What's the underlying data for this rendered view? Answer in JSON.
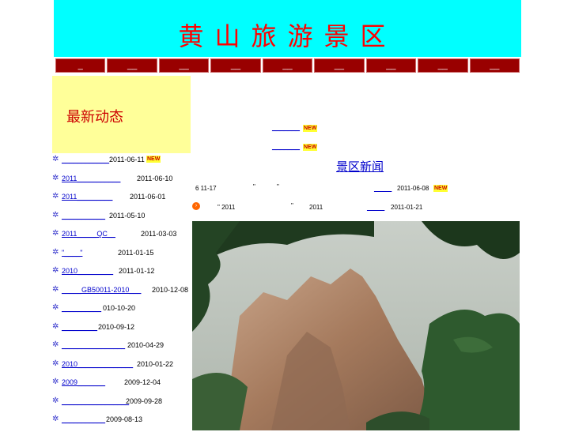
{
  "header": {
    "title": "黄山旅游景区"
  },
  "nav": {
    "items": [
      "_",
      "__",
      "__",
      "__",
      "__",
      "__",
      "__",
      "__",
      "__"
    ]
  },
  "sidebar": {
    "title": "最新动态",
    "items": [
      {
        "link": "____________",
        "date": "2011-06-11",
        "new": "NEW"
      },
      {
        "link": "2011___________",
        "date": "2011-06-10"
      },
      {
        "link": "2011_________",
        "date": "2011-06-01"
      },
      {
        "link": "___________",
        "date": "2011-05-10"
      },
      {
        "link": "2011_____QC__",
        "date": "2011-03-03"
      },
      {
        "link": "\"____\"",
        "date": "2011-01-15"
      },
      {
        "link": "2010_________",
        "date": "2011-01-12"
      },
      {
        "link": "_____GB50011-2010___",
        "date": "2010-12-08"
      },
      {
        "link": "__________",
        "date": "010-10-20"
      },
      {
        "link": "_________",
        "date": "2010-09-12"
      },
      {
        "link": "________________",
        "date": "2010-04-29"
      },
      {
        "link": "2010______________",
        "date": "2010-01-22"
      },
      {
        "link": "2009_______",
        "date": "2009-12-04"
      },
      {
        "link": "_________________",
        "date": "2009-09-28"
      },
      {
        "link": "___________",
        "date": "2009-08-13"
      }
    ]
  },
  "main": {
    "top_links": [
      {
        "text": "_______",
        "new": "NEW"
      },
      {
        "text": "_______",
        "new": "NEW"
      }
    ],
    "section_title": "景区新闻",
    "rows": [
      {
        "prefix": "6 11-17",
        "quote1": "\"",
        "quote2": "\"",
        "link": "_____",
        "date": "2011-06-08",
        "new": "NEW"
      },
      {
        "prefix": "\" 2011",
        "quote1": "\"",
        "mid": "2011",
        "link": "_____",
        "date": "2011-01-21"
      }
    ]
  },
  "colors": {
    "header_bg": "#00ffff",
    "title": "#ff0000",
    "nav_bg": "#990000",
    "sidebar_bg": "#ffff99",
    "link": "#0000cc"
  }
}
